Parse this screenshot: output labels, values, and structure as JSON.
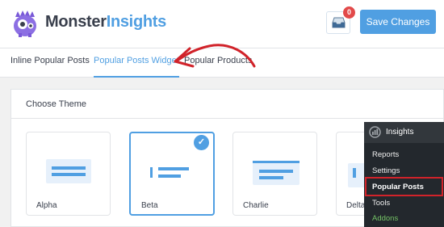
{
  "header": {
    "logo_word_1": "Monster",
    "logo_word_2": "Insights",
    "notification_count": "0",
    "save_label": "Save Changes"
  },
  "tabs": [
    {
      "label": "Inline Popular Posts",
      "active": false
    },
    {
      "label": "Popular Posts Widget",
      "active": true
    },
    {
      "label": "Popular Products",
      "active": false
    }
  ],
  "panel": {
    "title": "Choose Theme"
  },
  "themes": [
    {
      "name": "Alpha",
      "selected": false
    },
    {
      "name": "Beta",
      "selected": true
    },
    {
      "name": "Charlie",
      "selected": false
    },
    {
      "name": "Delta",
      "selected": false
    }
  ],
  "wp_menu": {
    "title": "Insights",
    "items": [
      "Reports",
      "Settings",
      "Popular Posts",
      "Tools",
      "Addons"
    ],
    "highlighted": "Popular Posts"
  },
  "colors": {
    "accent": "#509fe2",
    "dark": "#393f4c",
    "annotation_red": "#d1232a",
    "addons_green": "#74c366"
  }
}
